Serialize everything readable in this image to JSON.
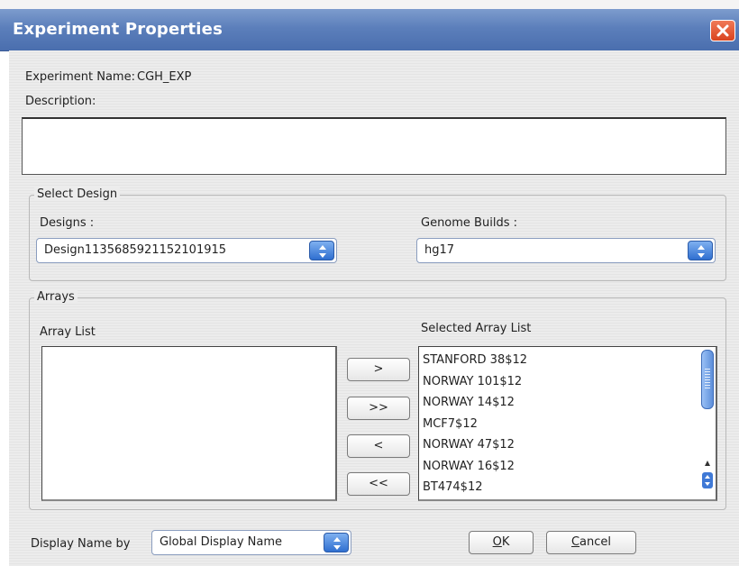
{
  "window": {
    "title": "Experiment Properties"
  },
  "experiment": {
    "name_label": "Experiment Name:",
    "name_value": "CGH_EXP",
    "description_label": "Description:",
    "description_value": ""
  },
  "select_design": {
    "group_title": "Select Design",
    "designs_label": "Designs :",
    "designs_value": "Design1135685921152101915",
    "genome_label": "Genome Builds :",
    "genome_value": "hg17"
  },
  "arrays": {
    "group_title": "Arrays",
    "array_list_label": "Array List",
    "array_list_items": [],
    "selected_label": "Selected Array List",
    "selected_items": [
      "STANFORD 38$12",
      "NORWAY 101$12",
      "NORWAY 14$12",
      "MCF7$12",
      "NORWAY 47$12",
      "NORWAY 16$12",
      "BT474$12"
    ],
    "move_buttons": [
      ">",
      ">>",
      "<",
      "<<"
    ]
  },
  "footer": {
    "display_name_label": "Display Name by",
    "display_name_value": "Global Display Name",
    "ok_mnemonic": "O",
    "ok_rest": "K",
    "cancel_mnemonic": "C",
    "cancel_rest": "ancel"
  },
  "colors": {
    "title_bar": "#5c7fbb",
    "close_button": "#d9431f",
    "combo_arrow": "#2f6fd0"
  }
}
